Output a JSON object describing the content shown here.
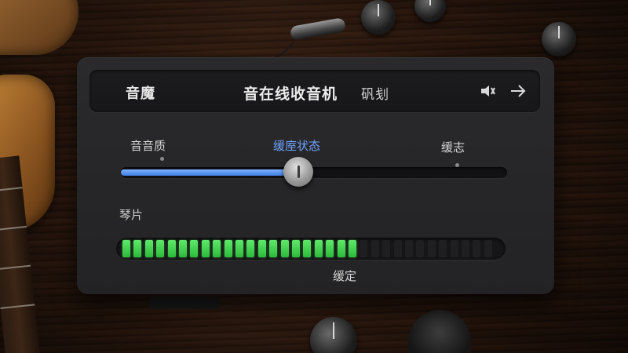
{
  "header": {
    "brand": "音魔",
    "title": "音在线收音机",
    "logo_text": "矾刬",
    "speaker_icon": "speaker-icon",
    "arrow_icon": "arrow-right-icon"
  },
  "slider": {
    "labels": [
      "音音质",
      "缓庢状态",
      "缓志"
    ],
    "active_label_color": "#6fa3ff",
    "value": 0.46,
    "fill_color": "#4f8ef0"
  },
  "meter": {
    "label": "琴片",
    "status": "缓定",
    "level": 0.63,
    "segments_on_color": "#45d052"
  }
}
